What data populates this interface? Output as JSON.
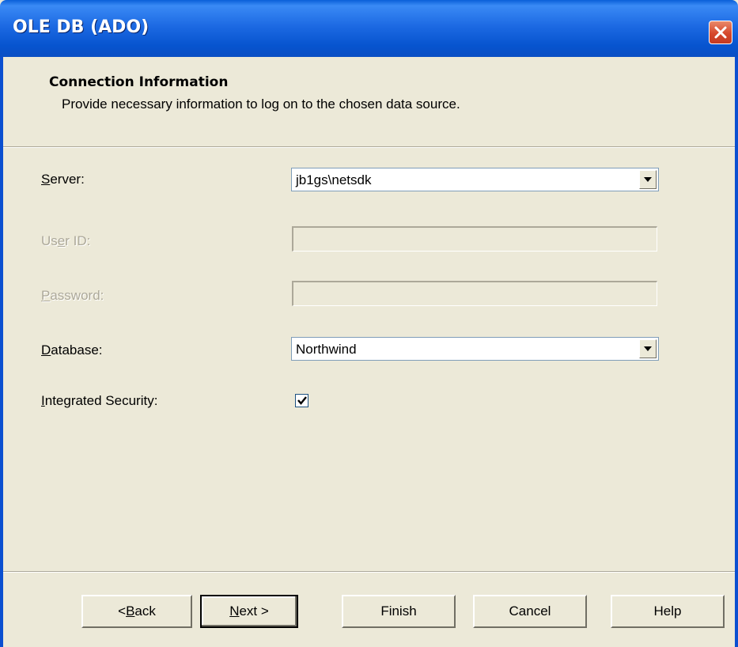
{
  "window": {
    "title": "OLE DB (ADO)"
  },
  "header": {
    "title": "Connection Information",
    "subtitle": "Provide necessary information to log on to the chosen data source."
  },
  "form": {
    "server": {
      "label_pre": "",
      "label_key": "S",
      "label_post": "erver:",
      "value": "jb1gs\\netsdk",
      "enabled": true
    },
    "user_id": {
      "label_pre": "Us",
      "label_key": "e",
      "label_post": "r ID:",
      "value": "",
      "enabled": false
    },
    "password": {
      "label_pre": "",
      "label_key": "P",
      "label_post": "assword:",
      "value": "",
      "enabled": false
    },
    "database": {
      "label_pre": "",
      "label_key": "D",
      "label_post": "atabase:",
      "value": "Northwind",
      "enabled": true
    },
    "integrated_security": {
      "label_pre": "",
      "label_key": "I",
      "label_post": "ntegrated Security:",
      "checked": true
    }
  },
  "buttons": {
    "back": {
      "pre": "< ",
      "key": "B",
      "post": "ack"
    },
    "next": {
      "pre": "",
      "key": "N",
      "post": "ext >"
    },
    "finish": {
      "label": "Finish"
    },
    "cancel": {
      "label": "Cancel"
    },
    "help": {
      "label": "Help"
    }
  },
  "icons": {
    "close": "close-icon",
    "dropdown": "chevron-down-icon",
    "check": "checkmark-icon"
  },
  "colors": {
    "titlebar": "#0a5fd8",
    "dialog_bg": "#ece9d8",
    "disabled_text": "#aca899",
    "close_button": "#d6482c"
  }
}
